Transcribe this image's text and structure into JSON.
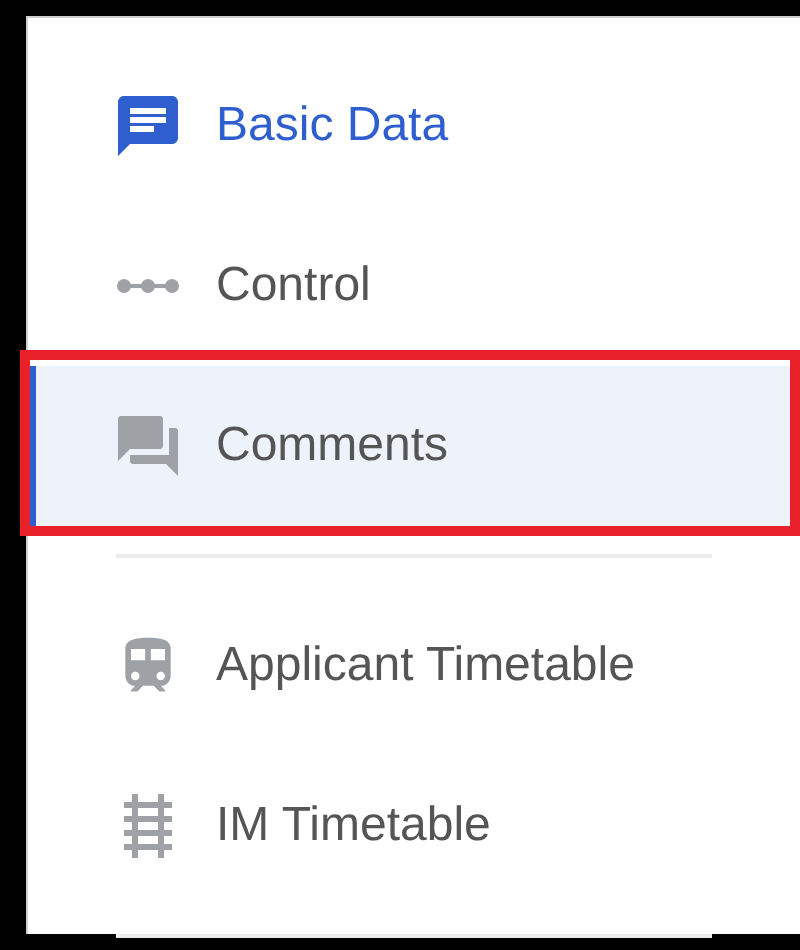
{
  "sections": [
    {
      "items": [
        {
          "label": "Basic Data",
          "selected": false,
          "active": true,
          "annotated": false
        },
        {
          "label": "Control",
          "selected": false,
          "active": false,
          "annotated": false
        },
        {
          "label": "Comments",
          "selected": true,
          "active": false,
          "annotated": true
        }
      ]
    },
    {
      "items": [
        {
          "label": "Applicant Timetable",
          "selected": false,
          "active": false,
          "annotated": false
        },
        {
          "label": "IM Timetable",
          "selected": false,
          "active": false,
          "annotated": false
        }
      ]
    }
  ]
}
